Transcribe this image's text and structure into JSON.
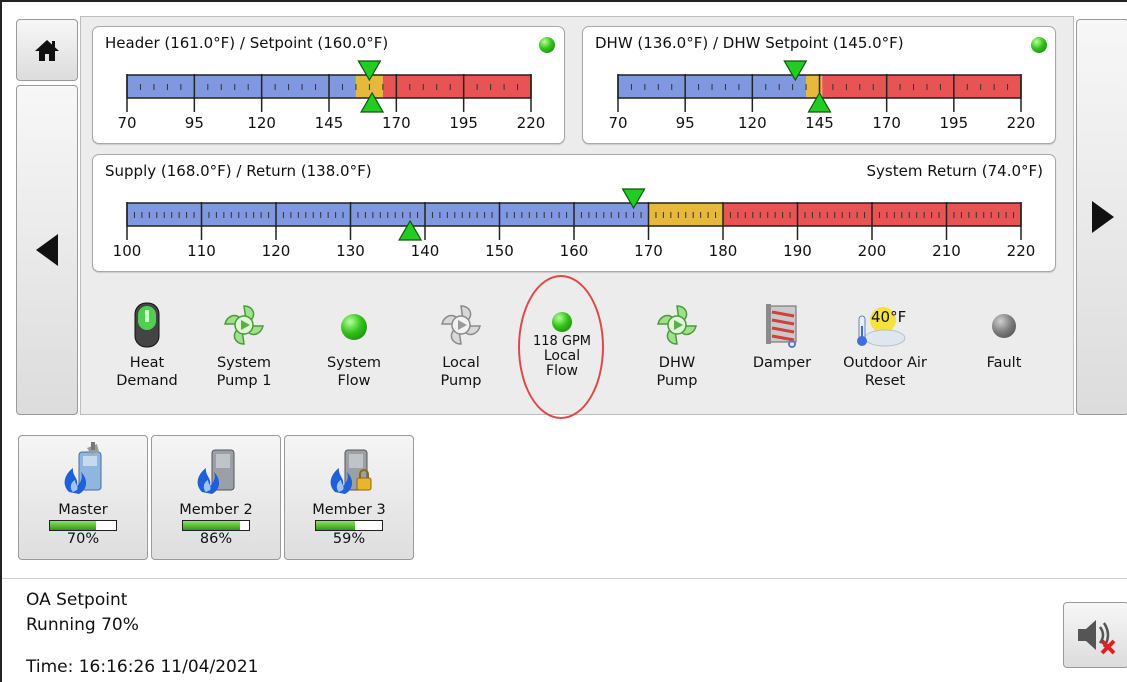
{
  "gauges": {
    "header": {
      "title": "Header (161.0°F) / Setpoint (160.0°F)",
      "ticks": [
        "70",
        "95",
        "120",
        "145",
        "170",
        "195",
        "220"
      ],
      "range": [
        70,
        220
      ],
      "blue_end": 155,
      "yellow_end": 165,
      "top_marker": 160,
      "bottom_marker": 161,
      "status_led": "green"
    },
    "dhw": {
      "title": "DHW (136.0°F) / DHW Setpoint (145.0°F)",
      "ticks": [
        "70",
        "95",
        "120",
        "145",
        "170",
        "195",
        "220"
      ],
      "range": [
        70,
        220
      ],
      "blue_end": 140,
      "yellow_end": 146,
      "top_marker": 136,
      "bottom_marker": 145,
      "status_led": "green"
    },
    "supply": {
      "title": "Supply (168.0°F) / Return (138.0°F)",
      "title_right": "System Return (74.0°F)",
      "ticks": [
        "100",
        "110",
        "120",
        "130",
        "140",
        "150",
        "160",
        "170",
        "180",
        "190",
        "200",
        "210",
        "220"
      ],
      "range": [
        100,
        220
      ],
      "blue_end": 170,
      "yellow_end": 180,
      "top_marker": 168,
      "bottom_marker": 138
    }
  },
  "status_items": [
    {
      "name": "heat-demand",
      "icon": "switch-icon",
      "line1": "Heat",
      "line2": "Demand"
    },
    {
      "name": "system-pump-1",
      "icon": "pump-icon",
      "line1": "System",
      "line2": "Pump 1"
    },
    {
      "name": "system-flow",
      "icon": "green-led-icon",
      "line1": "System",
      "line2": "Flow"
    },
    {
      "name": "local-pump",
      "icon": "pump-off-icon",
      "line1": "Local",
      "line2": "Pump"
    },
    {
      "name": "local-flow",
      "icon": "green-led-icon",
      "value": "118 GPM",
      "line1": "Local",
      "line2": "Flow"
    },
    {
      "name": "dhw-pump",
      "icon": "pump-icon",
      "line1": "DHW",
      "line2": "Pump"
    },
    {
      "name": "damper",
      "icon": "damper-icon",
      "line1": "Damper",
      "line2": ""
    },
    {
      "name": "outdoor-air-reset",
      "icon": "weather-icon",
      "badge": "40°F",
      "line1": "Outdoor Air",
      "line2": "Reset"
    },
    {
      "name": "fault",
      "icon": "gray-led-icon",
      "line1": "Fault",
      "line2": ""
    }
  ],
  "boilers": [
    {
      "name": "Master",
      "percent_label": "70%",
      "fill": 0.7
    },
    {
      "name": "Member 2",
      "percent_label": "86%",
      "fill": 0.86
    },
    {
      "name": "Member 3",
      "percent_label": "59%",
      "fill": 0.59
    }
  ],
  "status": {
    "line1": "OA Setpoint",
    "line2": "Running 70%",
    "time": "Time: 16:16:26 11/04/2021"
  },
  "colors": {
    "blue": "#7f98df",
    "yellow": "#e6b83b",
    "red": "#e85454",
    "marker": "#22cc22",
    "highlight": "#e04848"
  }
}
